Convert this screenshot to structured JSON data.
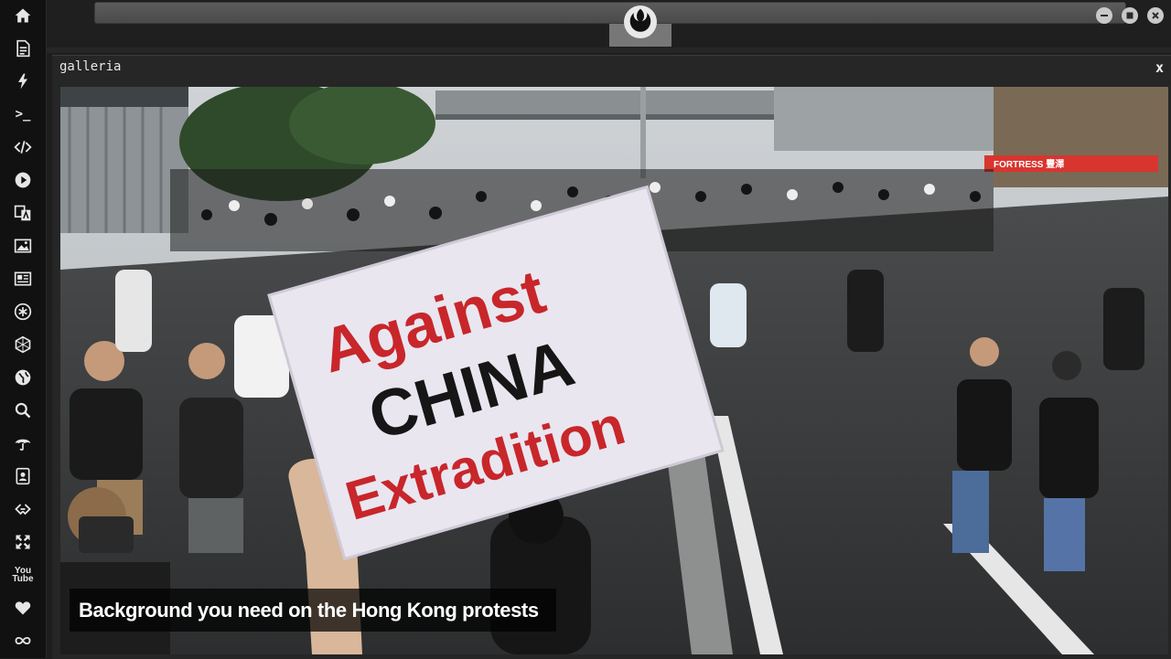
{
  "panel": {
    "title": "galleria",
    "close_label": "x"
  },
  "gallery": {
    "caption": "Background you need on the Hong Kong protests",
    "sign_lines": [
      "Against",
      "CHINA",
      "Extradition"
    ],
    "shop_sign": "FORTRESS  豐澤"
  },
  "rail": {
    "icons": [
      "home-icon",
      "document-icon",
      "bolt-icon",
      "terminal-icon",
      "code-icon",
      "play-icon",
      "translate-icon",
      "image-icon",
      "news-icon",
      "snowflake-icon",
      "hexagon-icon",
      "globe-icon",
      "search-icon",
      "umbrella-icon",
      "contact-icon",
      "link-icon",
      "expand-icon",
      "youtube-icon",
      "heart-icon",
      "infinity-icon"
    ],
    "terminal_glyph": ">_",
    "youtube_glyph": "You\nTube"
  },
  "colors": {
    "sign_red": "#c8262a",
    "sign_black": "#161616",
    "sign_paper": "#e9e6f0",
    "rail_bg": "#111111",
    "panel_bg": "#262626"
  }
}
